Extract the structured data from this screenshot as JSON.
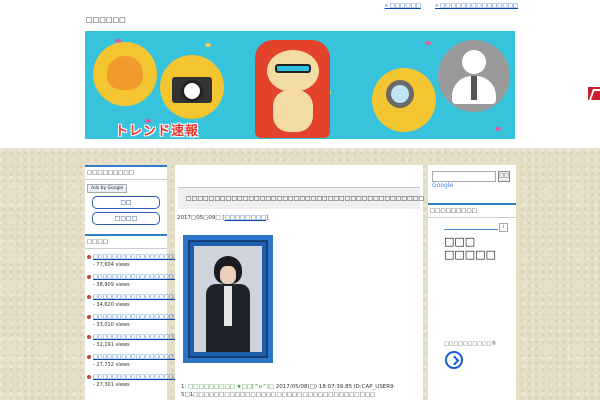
{
  "site": {
    "title": "□□□□□□",
    "top_links": [
      "□□□□□□",
      "□□□□□□□□□□□□□□□"
    ]
  },
  "banner": {
    "logo_text": "トレンド速報"
  },
  "left_sidebar": {
    "search_widget_title": "□□□□□□□□□",
    "ads_label": "Ads by Google",
    "buttons": [
      "□□",
      "□□□□"
    ],
    "ranking_title": "□□□□",
    "ranking": [
      {
        "title": "□□□□□□□□□□□□□□□□□□□□□□□□□",
        "views": " - 77,604 views"
      },
      {
        "title": "□□□□□□□□□□□□□□□□□□□□□□□□",
        "views": " - 38,909 views"
      },
      {
        "title": "□□□□□□□□□□□□□□□□□□□□□□□□",
        "views": " - 34,620 views"
      },
      {
        "title": "□□□□□□□□□□□□□□□□□□□□□□□□",
        "views": " - 33,010 views"
      },
      {
        "title": "□□□□□□□□□□□□□□□□□□□□□□□□",
        "views": " - 32,191 views"
      },
      {
        "title": "□□□□□□□□□□□□□□□□□□□□□□□□",
        "views": " - 27,732 views"
      },
      {
        "title": "□□□□□□□□□□□□□□□□□□□□□□□□",
        "views": " - 27,301 views"
      }
    ]
  },
  "post": {
    "title": "□□□□□□□□□□□□□□□□□□□□□□□□□□□□□□□□□□□□□□□□□□",
    "date": "2017□05□09□ [",
    "category": "□□□□□□□□",
    "date_end": "]",
    "comment_no": "1: ",
    "comment_name": "□□□□□□□□□ ★□□[^o^]□",
    "comment_meta": "2017/05/08(□) 18:07:39.85 ID:CAP_USER9·",
    "comment_body": "5□1□□□□□□□□□□□□□□□□□□□□□□□□□□□□□□□□□□□"
  },
  "right_sidebar": {
    "search_button": "□□",
    "google_label": "Google",
    "widget_title": "□□□□□□□□□",
    "ad_info": "i",
    "ad_text_line1": "□□□",
    "ad_text_line2": "□□□□□",
    "ad_small": "□□□□□□□□□□®"
  }
}
